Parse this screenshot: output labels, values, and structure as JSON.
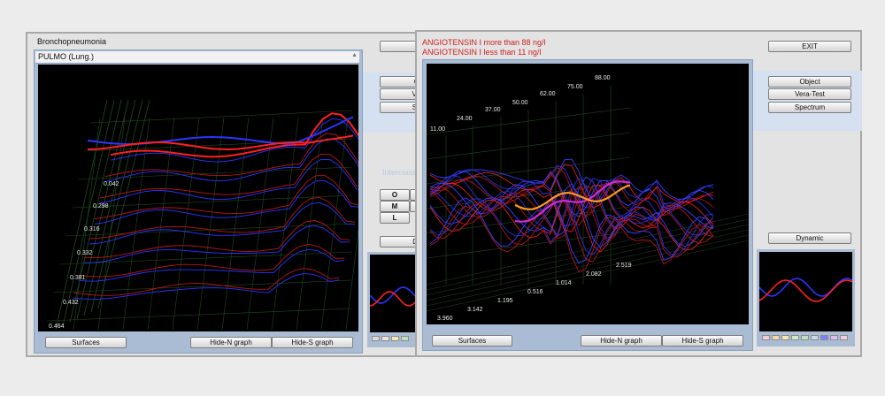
{
  "left_window": {
    "title": "Bronchopneumonia",
    "panel_title": "PULMO  (Lung.)",
    "buttons": {
      "surfaces": "Surfaces",
      "hide_n": "Hide-N graph",
      "hide_s": "Hide-S graph"
    },
    "side_buttons": {
      "exit": "",
      "b1": "O",
      "b2": "Vera",
      "b3": "Spe",
      "dynamic": "Dy"
    },
    "oml": [
      "O",
      "M",
      "L"
    ],
    "faint_text": "Interclass",
    "depth_labels": [
      "0.042",
      "0.298",
      "0.316",
      "0.332",
      "0.381",
      "0.432",
      "0.464"
    ]
  },
  "right_window": {
    "alert_lines": [
      "ANGIOTENSIN I more than 88 ng/l",
      "ANGIOTENSIN I less than 11 ng/l"
    ],
    "side_buttons": {
      "exit": "EXIT",
      "object": "Object",
      "vera_test": "Vera-Test",
      "spectrum": "Spectrum",
      "dynamic": "Dynamic"
    },
    "buttons": {
      "surfaces": "Surfaces",
      "hide_n": "Hide-N graph",
      "hide_s": "Hide-S graph"
    },
    "top_labels": [
      "11.00",
      "24.00",
      "37.00",
      "50.00",
      "62.00",
      "75.00",
      "88.00"
    ],
    "bottom_labels": [
      "3.960",
      "3.142",
      "1.195",
      "0.516",
      "1.014",
      "2.082",
      "2.519"
    ]
  },
  "colors": {
    "accent_red": "#cc1f1f",
    "blue_series": "#2b35ff",
    "red_series": "#e01818",
    "orange_series": "#ff9a1e",
    "magenta_series": "#d12bd6",
    "panel_blue": "#a9bcd3",
    "band_blue": "#d5e1f0"
  }
}
